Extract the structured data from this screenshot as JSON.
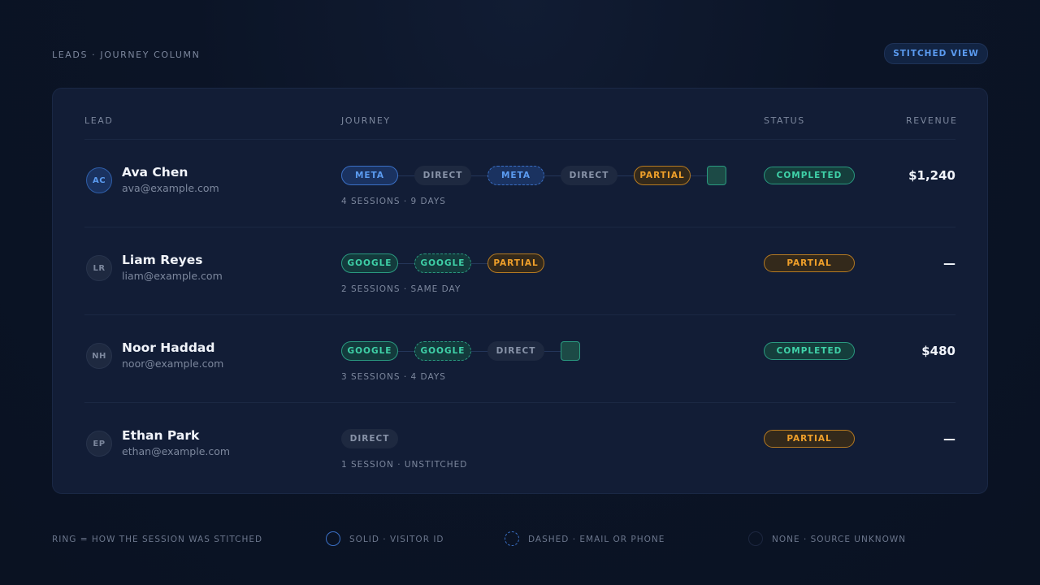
{
  "header": {
    "title": "LEADS · JOURNEY COLUMN",
    "view_badge": "STITCHED VIEW"
  },
  "columns": {
    "lead": "LEAD",
    "journey": "JOURNEY",
    "status": "STATUS",
    "revenue": "REVENUE"
  },
  "leads": [
    {
      "initials": "AC",
      "name": "Ava Chen",
      "email": "ava@example.com",
      "journey": [
        {
          "label": "META",
          "source": "meta",
          "ring": "solid"
        },
        {
          "label": "DIRECT",
          "source": "direct",
          "ring": "none"
        },
        {
          "label": "META",
          "source": "meta",
          "ring": "dashed"
        },
        {
          "label": "DIRECT",
          "source": "direct",
          "ring": "none"
        },
        {
          "label": "PARTIAL",
          "source": "partial",
          "ring": "solid"
        }
      ],
      "converted": true,
      "sessions": "4 SESSIONS · 9 DAYS",
      "status": "COMPLETED",
      "revenue": "$1,240"
    },
    {
      "initials": "LR",
      "name": "Liam Reyes",
      "email": "liam@example.com",
      "journey": [
        {
          "label": "GOOGLE",
          "source": "google",
          "ring": "solid"
        },
        {
          "label": "GOOGLE",
          "source": "google",
          "ring": "dashed"
        },
        {
          "label": "PARTIAL",
          "source": "partial",
          "ring": "solid"
        }
      ],
      "converted": false,
      "sessions": "2 SESSIONS · SAME DAY",
      "status": "PARTIAL",
      "revenue": "—"
    },
    {
      "initials": "NH",
      "name": "Noor Haddad",
      "email": "noor@example.com",
      "journey": [
        {
          "label": "GOOGLE",
          "source": "google",
          "ring": "solid"
        },
        {
          "label": "GOOGLE",
          "source": "google",
          "ring": "dashed"
        },
        {
          "label": "DIRECT",
          "source": "direct",
          "ring": "none"
        }
      ],
      "converted": true,
      "sessions": "3 SESSIONS · 4 DAYS",
      "status": "COMPLETED",
      "revenue": "$480"
    },
    {
      "initials": "EP",
      "name": "Ethan Park",
      "email": "ethan@example.com",
      "journey": [
        {
          "label": "DIRECT",
          "source": "direct",
          "ring": "none"
        }
      ],
      "converted": false,
      "sessions": "1 SESSION · UNSTITCHED",
      "status": "PARTIAL",
      "revenue": "—"
    }
  ],
  "legend": {
    "title": "RING = HOW THE SESSION WAS STITCHED",
    "items": [
      {
        "label": "SOLID · VISITOR ID",
        "icon": "solid-ring-icon"
      },
      {
        "label": "DASHED · EMAIL OR PHONE",
        "icon": "dashed-ring-icon"
      },
      {
        "label": "NONE · SOURCE UNKNOWN",
        "icon": "no-ring-icon"
      }
    ]
  },
  "colors": {
    "meta": "#5b9bf0",
    "google": "#3fd1a8",
    "partial": "#f0a02a",
    "direct": "#8893a8",
    "background": "#0b1426",
    "card": "#121d36"
  }
}
